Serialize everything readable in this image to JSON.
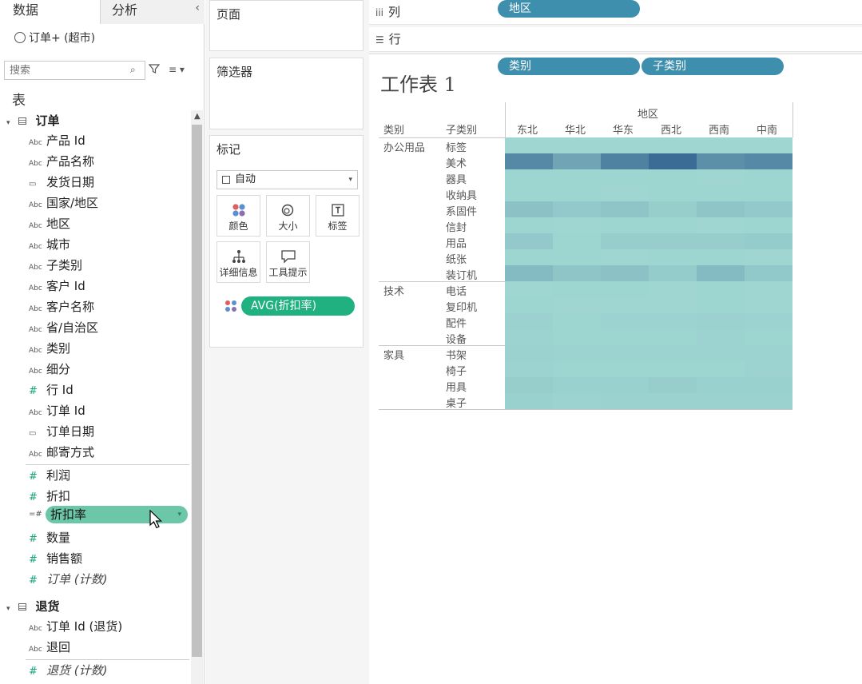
{
  "tabs": {
    "data": "数据",
    "analysis": "分析"
  },
  "collapse_glyph": "‹",
  "datasource": "订单+ (超市)",
  "search": {
    "placeholder": "搜索"
  },
  "tables_label": "表",
  "sections": [
    {
      "name": "订单",
      "fields": [
        {
          "icon": "Abc",
          "name": "产品 Id"
        },
        {
          "icon": "Abc",
          "name": "产品名称"
        },
        {
          "icon": "date",
          "name": "发货日期"
        },
        {
          "icon": "Abc",
          "name": "国家/地区"
        },
        {
          "icon": "Abc",
          "name": "地区"
        },
        {
          "icon": "Abc",
          "name": "城市"
        },
        {
          "icon": "Abc",
          "name": "子类别"
        },
        {
          "icon": "Abc",
          "name": "客户 Id"
        },
        {
          "icon": "Abc",
          "name": "客户名称"
        },
        {
          "icon": "Abc",
          "name": "省/自治区"
        },
        {
          "icon": "Abc",
          "name": "类别"
        },
        {
          "icon": "Abc",
          "name": "细分"
        },
        {
          "icon": "#",
          "name": "行 Id"
        },
        {
          "icon": "Abc",
          "name": "订单 Id"
        },
        {
          "icon": "date",
          "name": "订单日期"
        },
        {
          "icon": "Abc",
          "name": "邮寄方式"
        }
      ],
      "measures": [
        {
          "icon": "#",
          "name": "利润"
        },
        {
          "icon": "#",
          "name": "折扣"
        },
        {
          "icon": "=#",
          "name": "折扣率",
          "dragging": true
        },
        {
          "icon": "#",
          "name": "数量"
        },
        {
          "icon": "#",
          "name": "销售额"
        },
        {
          "icon": "#",
          "name": "订单 (计数)",
          "italic": true
        }
      ]
    },
    {
      "name": "退货",
      "fields": [
        {
          "icon": "Abc",
          "name": "订单 Id (退货)"
        },
        {
          "icon": "Abc",
          "name": "退回"
        }
      ],
      "measures": [
        {
          "icon": "#",
          "name": "退货 (计数)",
          "italic": true
        }
      ]
    }
  ],
  "cards": {
    "pages": "页面",
    "filters": "筛选器",
    "marks": "标记",
    "mark_type": "自动",
    "buttons": {
      "color": "颜色",
      "size": "大小",
      "label": "标签",
      "detail": "详细信息",
      "tooltip": "工具提示"
    },
    "measure_pill": "AVG(折扣率)"
  },
  "shelves": {
    "columns_label": "列",
    "rows_label": "行",
    "columns": [
      "地区"
    ],
    "rows": [
      "类别",
      "子类别"
    ]
  },
  "sheet_title": "工作表 1",
  "colors": {
    "pill_blue": "#3e8fad",
    "measure_green": "#1fb280",
    "dragged_green": "#6cc7a9",
    "heat_low": "#a7dfd6",
    "heat_high": "#1f4f85"
  },
  "chart_data": {
    "type": "heatmap",
    "title": "工作表 1",
    "column_header": "地区",
    "row_headers": [
      "类别",
      "子类别"
    ],
    "columns": [
      "东北",
      "华北",
      "华东",
      "西北",
      "西南",
      "中南"
    ],
    "groups": [
      {
        "category": "办公用品",
        "subcategories": [
          "标签",
          "美术",
          "器具",
          "收纳具",
          "系固件",
          "信封",
          "用品",
          "纸张",
          "装订机"
        ]
      },
      {
        "category": "技术",
        "subcategories": [
          "电话",
          "复印机",
          "配件",
          "设备"
        ]
      },
      {
        "category": "家具",
        "subcategories": [
          "书架",
          "椅子",
          "用具",
          "桌子"
        ]
      }
    ],
    "values": [
      [
        0.06,
        0.06,
        0.06,
        0.06,
        0.06,
        0.06
      ],
      [
        0.6,
        0.4,
        0.65,
        0.8,
        0.55,
        0.6
      ],
      [
        0.07,
        0.07,
        0.07,
        0.07,
        0.06,
        0.07
      ],
      [
        0.07,
        0.07,
        0.06,
        0.07,
        0.07,
        0.07
      ],
      [
        0.2,
        0.15,
        0.18,
        0.12,
        0.18,
        0.15
      ],
      [
        0.07,
        0.06,
        0.07,
        0.07,
        0.06,
        0.07
      ],
      [
        0.15,
        0.07,
        0.12,
        0.12,
        0.12,
        0.14
      ],
      [
        0.07,
        0.07,
        0.06,
        0.07,
        0.07,
        0.06
      ],
      [
        0.26,
        0.18,
        0.2,
        0.14,
        0.26,
        0.16
      ],
      [
        0.06,
        0.07,
        0.07,
        0.06,
        0.07,
        0.06
      ],
      [
        0.07,
        0.06,
        0.06,
        0.06,
        0.07,
        0.06
      ],
      [
        0.09,
        0.07,
        0.08,
        0.08,
        0.09,
        0.08
      ],
      [
        0.08,
        0.07,
        0.07,
        0.07,
        0.08,
        0.07
      ],
      [
        0.09,
        0.08,
        0.08,
        0.08,
        0.08,
        0.08
      ],
      [
        0.08,
        0.07,
        0.07,
        0.07,
        0.07,
        0.08
      ],
      [
        0.12,
        0.1,
        0.1,
        0.12,
        0.1,
        0.1
      ],
      [
        0.1,
        0.08,
        0.09,
        0.09,
        0.09,
        0.09
      ]
    ],
    "color_range": [
      "#a7dfd6",
      "#1f4f85"
    ]
  }
}
